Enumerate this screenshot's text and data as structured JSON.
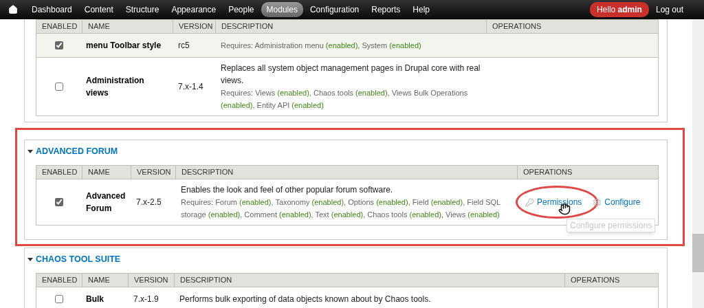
{
  "toolbar": {
    "items": [
      {
        "label": "Dashboard",
        "selected": false
      },
      {
        "label": "Content",
        "selected": false
      },
      {
        "label": "Structure",
        "selected": false
      },
      {
        "label": "Appearance",
        "selected": false
      },
      {
        "label": "People",
        "selected": false
      },
      {
        "label": "Modules",
        "selected": true
      },
      {
        "label": "Configuration",
        "selected": false
      },
      {
        "label": "Reports",
        "selected": false
      },
      {
        "label": "Help",
        "selected": false
      }
    ],
    "user": "Hello **admin**",
    "logout": "Log out"
  },
  "sections": [
    {
      "columns": [
        "ENABLED",
        "NAME",
        "VERSION",
        "DESCRIPTION",
        "OPERATIONS"
      ],
      "rows": [
        {
          "enabled": true,
          "striped": true,
          "name": "menu Toolbar style",
          "version": "rc5",
          "requires": [
            {
              "kind": "text",
              "text": "Requires: Administration menu "
            },
            {
              "kind": "status",
              "text": "(enabled)"
            },
            {
              "kind": "text",
              "text": ", System "
            },
            {
              "kind": "status",
              "text": "(enabled)"
            }
          ],
          "operations": []
        },
        {
          "enabled": false,
          "striped": false,
          "name": "Administration views",
          "version": "7.x-1.4",
          "description": "Replaces all system object management pages in Drupal core with real views.",
          "requires": [
            {
              "kind": "text",
              "text": "Requires: Views "
            },
            {
              "kind": "status",
              "text": "(enabled)"
            },
            {
              "kind": "text",
              "text": ", Chaos tools "
            },
            {
              "kind": "status",
              "text": "(enabled)"
            },
            {
              "kind": "text",
              "text": ", Views Bulk Operations "
            },
            {
              "kind": "status",
              "text": "(enabled)"
            },
            {
              "kind": "text",
              "text": ", Entity API "
            },
            {
              "kind": "status",
              "text": "(enabled)"
            }
          ],
          "operations": []
        }
      ]
    },
    {
      "title": "ADVANCED FORUM",
      "expanded": true,
      "highlighted": true,
      "columns": [
        "ENABLED",
        "NAME",
        "VERSION",
        "DESCRIPTION",
        "OPERATIONS"
      ],
      "rows": [
        {
          "enabled": true,
          "striped": false,
          "name": "Advanced Forum",
          "version": "7.x-2.5",
          "description": "Enables the look and feel of other popular forum software.",
          "requires": [
            {
              "kind": "text",
              "text": "Requires: Forum "
            },
            {
              "kind": "status",
              "text": "(enabled)"
            },
            {
              "kind": "text",
              "text": ", Taxonomy "
            },
            {
              "kind": "status",
              "text": "(enabled)"
            },
            {
              "kind": "text",
              "text": ", Options "
            },
            {
              "kind": "status",
              "text": "(enabled)"
            },
            {
              "kind": "text",
              "text": ", Field "
            },
            {
              "kind": "status",
              "text": "(enabled)"
            },
            {
              "kind": "text",
              "text": ", Field SQL storage "
            },
            {
              "kind": "status",
              "text": "(enabled)"
            },
            {
              "kind": "text",
              "text": ", Comment "
            },
            {
              "kind": "status",
              "text": "(enabled)"
            },
            {
              "kind": "text",
              "text": ", Text "
            },
            {
              "kind": "status",
              "text": "(enabled)"
            },
            {
              "kind": "text",
              "text": ", Chaos tools "
            },
            {
              "kind": "status",
              "text": "(enabled)"
            },
            {
              "kind": "text",
              "text": ", Views "
            },
            {
              "kind": "status",
              "text": "(enabled)"
            }
          ],
          "operations": [
            {
              "kind": "permissions",
              "label": "Permissions",
              "highlighted": true,
              "tooltip": "Configure permissions"
            },
            {
              "kind": "configure",
              "label": "Configure",
              "highlighted": false
            }
          ]
        }
      ]
    },
    {
      "title": "CHAOS TOOL SUITE",
      "expanded": true,
      "highlighted": false,
      "columns": [
        "ENABLED",
        "NAME",
        "VERSION",
        "DESCRIPTION",
        "OPERATIONS"
      ],
      "rows": [
        {
          "enabled": false,
          "striped": false,
          "name": "Bulk",
          "version": "7.x-1.9",
          "description": "Performs bulk exporting of data objects known about by Chaos tools.",
          "requires": [],
          "operations": []
        }
      ]
    }
  ]
}
